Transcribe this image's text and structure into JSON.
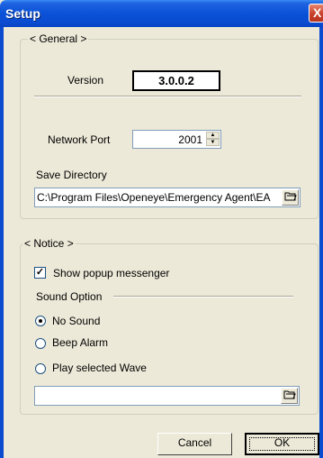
{
  "window": {
    "title": "Setup",
    "close_glyph": "X"
  },
  "general": {
    "group_label": "< General >",
    "version_label": "Version",
    "version_value": "3.0.0.2",
    "network_port_label": "Network Port",
    "network_port_value": "2001",
    "save_directory_label": "Save Directory",
    "save_directory_value": "C:\\Program Files\\Openeye\\Emergency Agent\\EA"
  },
  "notice": {
    "group_label": "< Notice >",
    "show_popup_label": "Show popup messenger",
    "show_popup_checked": true,
    "sound_option_label": "Sound Option",
    "sound_options": [
      {
        "label": "No Sound",
        "selected": true
      },
      {
        "label": "Beep Alarm",
        "selected": false
      },
      {
        "label": "Play selected Wave",
        "selected": false
      }
    ],
    "wave_value": ""
  },
  "buttons": {
    "cancel": "Cancel",
    "ok": "OK"
  },
  "icons": {
    "browse": "folder-browse-icon",
    "spin": "spin-arrows-icon",
    "close": "close-icon"
  },
  "colors": {
    "titlebar": "#0a52d8",
    "background": "#ece9d8",
    "close": "#c7402a"
  }
}
